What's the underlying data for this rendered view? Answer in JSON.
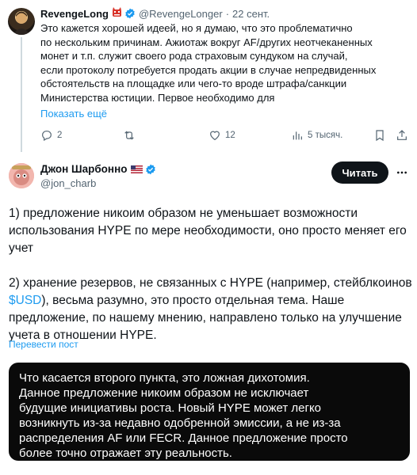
{
  "tweet1": {
    "author_name": "RevengeLong",
    "author_handle": "@RevengeLonger",
    "separator": "·",
    "date": "22 сент.",
    "text_lines": [
      "Это кажется хорошей идеей, но я думаю, что это проблематично",
      "по нескольким причинам. Ажиотаж вокруг AF/других неотчеканенных",
      "монет и т.п. служит своего рода страховым сундуком на случай,",
      "если протоколу потребуется продать акции в случае непредвиденных",
      "обстоятельств на площадке или чего-то вроде штрафа/санкции",
      "Министерства юстиции. Первое необходимо для"
    ],
    "show_more": "Показать ещё",
    "actions": {
      "replies": "2",
      "reposts": "",
      "likes": "12",
      "views": "5 тысяч."
    }
  },
  "tweet2": {
    "author_name": "Джон Шарбонно",
    "author_handle": "@jon_charb",
    "follow_label": "Читать",
    "para1": "1) предложение никоим образом не уменьшает возможности использования HYPE по мере необходимости, оно просто меняет его учет",
    "para2_before": "2) хранение резервов, не связанных с HYPE (например, стейблкоинов ",
    "para2_cashtag": "$USD",
    "para2_after": "), весьма разумно, это просто отдельная тема. Наше предложение, по нашему мнению, направлено только на улучшение учета в отношении HYPE.",
    "translate": "Перевести пост",
    "quote_text": "Что касается второго пункта, это ложная дихотомия.\nДанное предложение никоим образом не исключает\nбудущие инициативы роста. Новый HYPE может легко\nвозникнуть из-за недавно одобренной эмиссии, а не из-за\nраспределения AF или FECR. Данное предложение просто\nболее точно отражает эту реальность."
  },
  "colors": {
    "accent": "#1d9bf0",
    "text": "#0f1419",
    "muted": "#536471",
    "dark_box": "#0a0a0a"
  }
}
